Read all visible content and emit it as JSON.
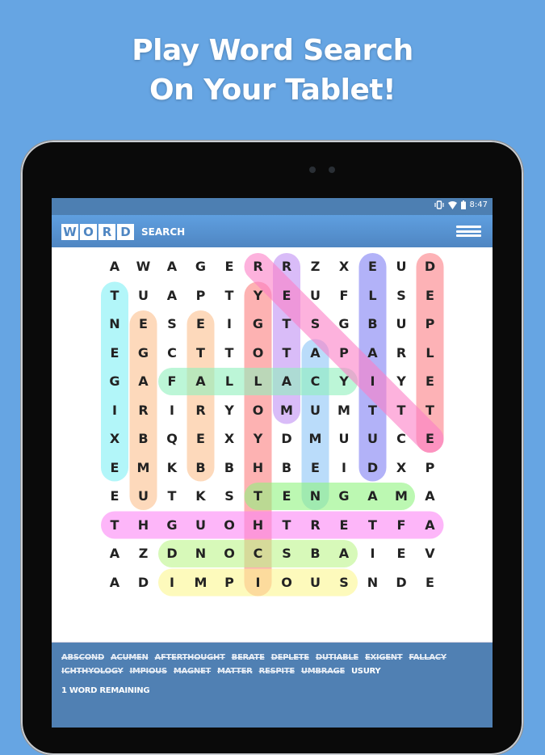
{
  "promo": {
    "line1": "Play Word Search",
    "line2": "On Your Tablet!"
  },
  "statusbar": {
    "time": "8:47",
    "icons": [
      "vibrate-icon",
      "wifi-icon",
      "battery-icon"
    ]
  },
  "appbar": {
    "logo_tiles": [
      "W",
      "O",
      "R",
      "D"
    ],
    "logo_text": "SEARCH",
    "menu_icon": "hamburger-menu-icon"
  },
  "grid": {
    "rows": [
      [
        "A",
        "W",
        "A",
        "G",
        "E",
        "R",
        "R",
        "Z",
        "X",
        "E",
        "U",
        "D"
      ],
      [
        "T",
        "U",
        "A",
        "P",
        "T",
        "Y",
        "E",
        "U",
        "F",
        "L",
        "S",
        "E"
      ],
      [
        "N",
        "E",
        "S",
        "E",
        "I",
        "G",
        "T",
        "S",
        "G",
        "B",
        "U",
        "P"
      ],
      [
        "E",
        "G",
        "C",
        "T",
        "T",
        "O",
        "T",
        "A",
        "P",
        "A",
        "R",
        "L"
      ],
      [
        "G",
        "A",
        "F",
        "A",
        "L",
        "L",
        "A",
        "C",
        "Y",
        "I",
        "Y",
        "E"
      ],
      [
        "I",
        "R",
        "I",
        "R",
        "Y",
        "O",
        "M",
        "U",
        "M",
        "T",
        "T",
        "T"
      ],
      [
        "X",
        "B",
        "Q",
        "E",
        "X",
        "Y",
        "D",
        "M",
        "U",
        "U",
        "C",
        "E"
      ],
      [
        "E",
        "M",
        "K",
        "B",
        "B",
        "H",
        "B",
        "E",
        "I",
        "D",
        "X",
        "P"
      ],
      [
        "E",
        "U",
        "T",
        "K",
        "S",
        "T",
        "E",
        "N",
        "G",
        "A",
        "M",
        "A"
      ],
      [
        "T",
        "H",
        "G",
        "U",
        "O",
        "H",
        "T",
        "R",
        "E",
        "T",
        "F",
        "A"
      ],
      [
        "A",
        "Z",
        "D",
        "N",
        "O",
        "C",
        "S",
        "B",
        "A",
        "I",
        "E",
        "V"
      ],
      [
        "A",
        "D",
        "I",
        "M",
        "P",
        "I",
        "O",
        "U",
        "S",
        "N",
        "D",
        "E"
      ]
    ]
  },
  "found_words": [
    {
      "word": "EXIGENT",
      "start": [
        7,
        0
      ],
      "end": [
        1,
        0
      ],
      "color": "#7ff0f5"
    },
    {
      "word": "UMBRAGE",
      "start": [
        8,
        1
      ],
      "end": [
        2,
        1
      ],
      "color": "#fbc08d"
    },
    {
      "word": "BERATE",
      "start": [
        7,
        3
      ],
      "end": [
        2,
        3
      ],
      "color": "#fbc08d"
    },
    {
      "word": "ICHTHYOLOGY",
      "start": [
        11,
        5
      ],
      "end": [
        1,
        5
      ],
      "color": "#fb7e7e"
    },
    {
      "word": "MATTER",
      "start": [
        5,
        6
      ],
      "end": [
        0,
        6
      ],
      "color": "#c08ff3"
    },
    {
      "word": "ACUMEN",
      "start": [
        3,
        7
      ],
      "end": [
        8,
        7
      ],
      "color": "#8cc4f7"
    },
    {
      "word": "DUTIABLE",
      "start": [
        7,
        9
      ],
      "end": [
        0,
        9
      ],
      "color": "#7f7ff4"
    },
    {
      "word": "DEPLETE",
      "start": [
        0,
        11
      ],
      "end": [
        6,
        11
      ],
      "color": "#fb7e85"
    },
    {
      "word": "FALLACY",
      "start": [
        4,
        2
      ],
      "end": [
        4,
        8
      ],
      "color": "#8ff0bd"
    },
    {
      "word": "MAGNET",
      "start": [
        8,
        10
      ],
      "end": [
        8,
        5
      ],
      "color": "#8ff37f"
    },
    {
      "word": "AFTERTHOUGHT",
      "start": [
        9,
        11
      ],
      "end": [
        9,
        0
      ],
      "color": "#fb85f5"
    },
    {
      "word": "ABSCOND",
      "start": [
        10,
        8
      ],
      "end": [
        10,
        2
      ],
      "color": "#bdf58a"
    },
    {
      "word": "IMPIOUS",
      "start": [
        11,
        2
      ],
      "end": [
        11,
        8
      ],
      "color": "#fbf78f"
    },
    {
      "word": "RESPITE",
      "start": [
        0,
        5
      ],
      "end": [
        6,
        11
      ],
      "color": "#fb7ec6"
    }
  ],
  "wordlist": [
    {
      "word": "ABSCOND",
      "found": true
    },
    {
      "word": "ACUMEN",
      "found": true
    },
    {
      "word": "AFTERTHOUGHT",
      "found": true
    },
    {
      "word": "BERATE",
      "found": true
    },
    {
      "word": "DEPLETE",
      "found": true
    },
    {
      "word": "DUTIABLE",
      "found": true
    },
    {
      "word": "EXIGENT",
      "found": true
    },
    {
      "word": "FALLACY",
      "found": true
    },
    {
      "word": "ICHTHYOLOGY",
      "found": true
    },
    {
      "word": "IMPIOUS",
      "found": true
    },
    {
      "word": "MAGNET",
      "found": true
    },
    {
      "word": "MATTER",
      "found": true
    },
    {
      "word": "RESPITE",
      "found": true
    },
    {
      "word": "UMBRAGE",
      "found": true
    },
    {
      "word": "USURY",
      "found": false
    }
  ],
  "remaining_text": "1 WORD REMAINING",
  "colors": {
    "background": "#66a5e3",
    "statusbar": "#4d7fb2",
    "appbar": "#5a94d3",
    "wordpanel": "#5080b3"
  }
}
